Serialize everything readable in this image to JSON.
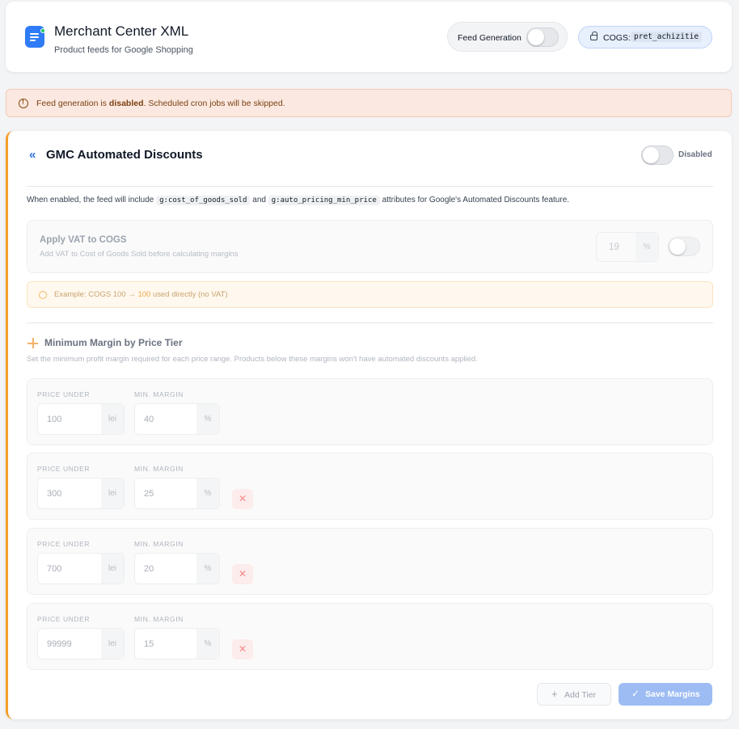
{
  "header": {
    "title": "Merchant Center XML",
    "subtitle": "Product feeds for Google Shopping",
    "feed_generation_label": "Feed Generation",
    "feed_generation_enabled": false,
    "cogs_label": "COGS:",
    "cogs_field": "pret_achizitie"
  },
  "banner": {
    "text_before": "Feed generation is ",
    "text_bold": "disabled",
    "text_after": ". Scheduled cron jobs will be skipped.",
    "icon": "alert-circle-icon"
  },
  "gmc": {
    "title": "GMC Automated Discounts",
    "status_label": "Disabled",
    "enabled": false,
    "desc_before": "When enabled, the feed will include",
    "attr1": "g:cost_of_goods_sold",
    "desc_and": "and",
    "attr2": "g:auto_pricing_min_price",
    "desc_after": "attributes for Google's Automated Discounts feature."
  },
  "vat": {
    "title": "Apply VAT to COGS",
    "subtitle": "Add VAT to Cost of Goods Sold before calculating margins",
    "value": "19",
    "unit": "%",
    "enabled": false
  },
  "example": {
    "prefix": "Example: COGS 100 → ",
    "highlight": "100",
    "suffix": " used directly (no VAT)"
  },
  "tiers": {
    "title": "Minimum Margin by Price Tier",
    "description": "Set the minimum profit margin required for each price range. Products below these margins won't have automated discounts applied.",
    "price_label": "PRICE UNDER",
    "margin_label": "MIN. MARGIN",
    "currency": "lei",
    "percent": "%",
    "delete_symbol": "✕",
    "rows": [
      {
        "price": "100",
        "margin": "40"
      },
      {
        "price": "300",
        "margin": "25"
      },
      {
        "price": "700",
        "margin": "20"
      },
      {
        "price": "99999",
        "margin": "15"
      }
    ]
  },
  "actions": {
    "add_tier": "Add Tier",
    "save": "Save Margins"
  },
  "colors": {
    "accent": "#f59e2b",
    "primary": "#2f7cf6",
    "banner_bg": "#fbe9e1"
  }
}
